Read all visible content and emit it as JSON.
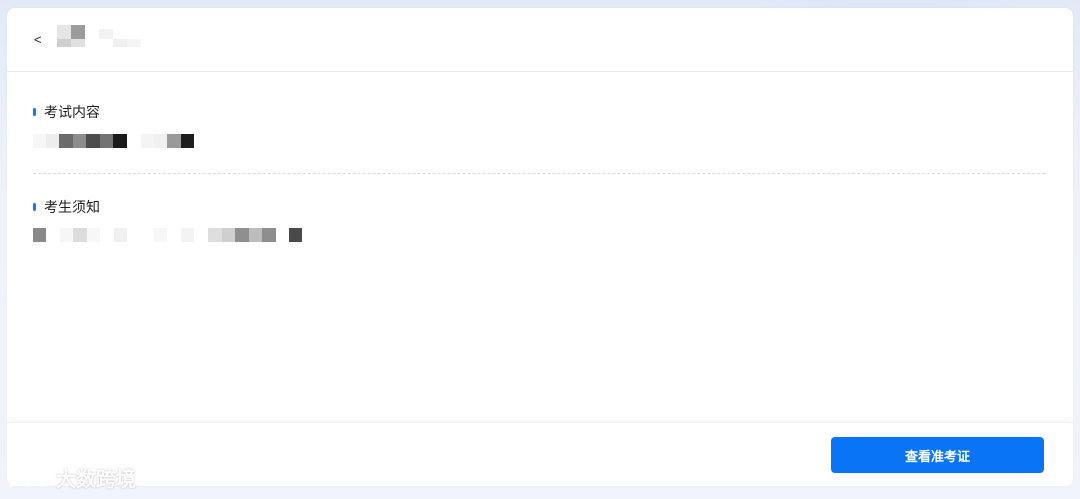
{
  "header": {
    "back_icon": "<",
    "title_redacted": true
  },
  "sections": [
    {
      "title": "考试内容",
      "content_redacted": true
    },
    {
      "title": "考生须知",
      "content_redacted": true
    }
  ],
  "footer": {
    "primary_button_label": "查看准考证"
  },
  "watermark": {
    "text": "大数跨境"
  },
  "colors": {
    "accent": "#0a74f6",
    "dot": "#1677ff",
    "background": "#e9eef8",
    "card": "#ffffff"
  }
}
